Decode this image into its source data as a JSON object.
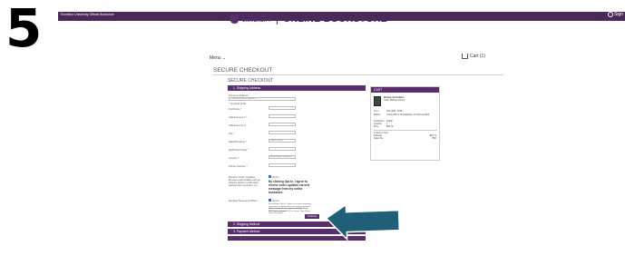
{
  "step": "5",
  "topbar": {
    "store_name": "Excelsior University Official Bookstore",
    "signin": "Sign"
  },
  "header": {
    "uni_line1": "EXCELSIOR",
    "uni_line2": "UNIVERSITY",
    "bookstore": "ONLINE BOOKSTORE"
  },
  "nav": {
    "menu": "Menu ⌄",
    "cart": "Cart (1)"
  },
  "page": {
    "title": "SECURE CHECKOUT",
    "subtitle": "SECURE CHECKOUT"
  },
  "sections": {
    "shipping_address": "1. Shipping Address",
    "shipping_method": "2. Shipping Method",
    "payment_method": "3. Payment Method"
  },
  "form": {
    "previous_address_label": "Previous Address",
    "previous_address_value": "-- Select a Previous Address --",
    "required_note": "* required fields",
    "full_name": "Full Name *",
    "address1": "Address Line 1 *",
    "address2": "Address Line 2",
    "city": "City *",
    "state": "State/Province *",
    "state_value": "Select a State",
    "zip": "Zip/Postal Code *",
    "country": "Country *",
    "country_value": "United States of America",
    "phone": "Phone Number *",
    "order_updates_label": "Receive Order Updates",
    "order_updates_desc": "Receive email updates such as shipping delivery confirmation, special return reminders, etc.",
    "opt_in": "Opt-In",
    "order_updates_consent": "By clicking Opt-In, I agree to receive order updates via text message from my online bookstore.",
    "news_label": "Receive News and Offers",
    "news_consent": "By selecting 'Opt-In' I agree to receive marketing messages, including discounts and promotional events, at the phone number provided. Reply HELP for help and STOP to cancel. Msg & data rates may apply.",
    "news_note": "SMS notifications are only available for U.S. phone numbers.",
    "continue": "Continue"
  },
  "cart": {
    "title": "CART",
    "item_title": "Biology 2nd Edition",
    "item_author": "Clark, Michael (Open)",
    "rows": [
      {
        "k": "Term",
        "v": "Fall 1948 - 2025"
      },
      {
        "k": "Edition",
        "v": "Course BIO 170 Adaptation of Cabrera 2023"
      },
      {
        "k": "Conditions",
        "v": "Digital"
      },
      {
        "k": "Quantity",
        "v": "1"
      },
      {
        "k": "Price",
        "v": "$64.74"
      }
    ],
    "summary_head": "1 Items in Cart",
    "subtotal_label": "Subtotal",
    "subtotal_value": "$64.74",
    "tax_label": "Sales Tax",
    "tax_value": "TBD"
  }
}
